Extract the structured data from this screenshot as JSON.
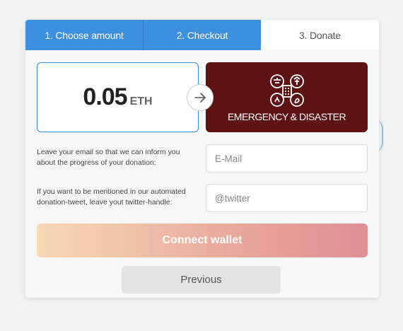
{
  "tabs": [
    {
      "label": "1. Choose amount",
      "state": "done"
    },
    {
      "label": "2. Checkout",
      "state": "done"
    },
    {
      "label": "3. Donate",
      "state": "current"
    }
  ],
  "amount": {
    "value": "0.05",
    "unit": "ETH"
  },
  "cause": {
    "label": "EMERGENCY & DISASTER",
    "icon": "emergency-disaster-icon"
  },
  "email": {
    "label": "Leave your email so that we can inform you about the progress of your donation:",
    "placeholder": "E-Mail"
  },
  "twitter": {
    "label": "If you want to be mentioned in our automated donation-tweet, leave yout twitter-handle:",
    "placeholder": "@twitter"
  },
  "buttons": {
    "connect": "Connect wallet",
    "previous": "Previous"
  },
  "colors": {
    "accent": "#3d8fe0",
    "cause_bg": "#5e1212",
    "connect_gradient_start": "#f7d9b4",
    "connect_gradient_end": "#df8e92",
    "previous_bg": "#e3e3e3"
  }
}
